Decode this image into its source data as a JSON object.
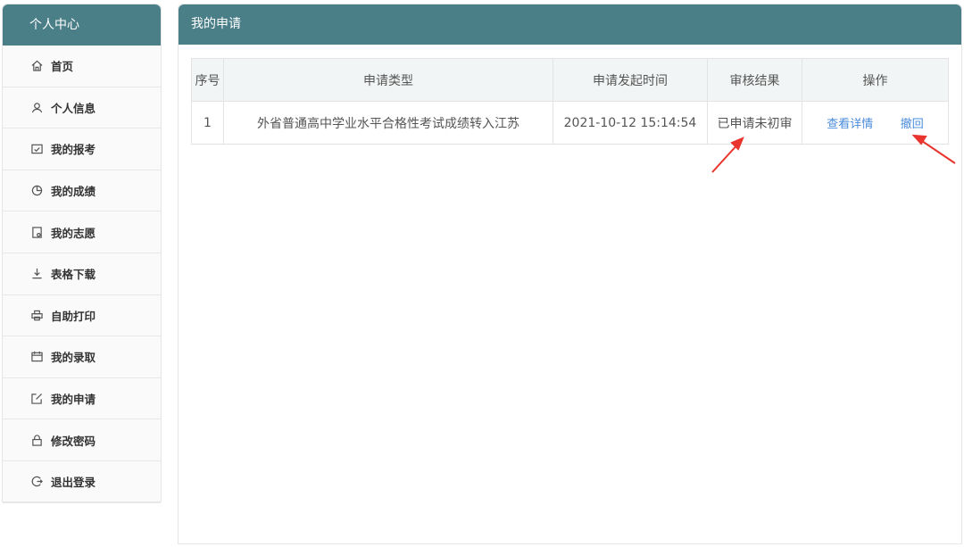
{
  "sidebar": {
    "title": "个人中心",
    "items": [
      {
        "label": "首页",
        "icon": "home-icon"
      },
      {
        "label": "个人信息",
        "icon": "user-icon"
      },
      {
        "label": "我的报考",
        "icon": "calendar-check-icon"
      },
      {
        "label": "我的成绩",
        "icon": "pie-chart-icon"
      },
      {
        "label": "我的志愿",
        "icon": "document-icon"
      },
      {
        "label": "表格下载",
        "icon": "download-icon"
      },
      {
        "label": "自助打印",
        "icon": "printer-icon"
      },
      {
        "label": "我的录取",
        "icon": "calendar-icon"
      },
      {
        "label": "我的申请",
        "icon": "edit-icon"
      },
      {
        "label": "修改密码",
        "icon": "lock-icon"
      },
      {
        "label": "退出登录",
        "icon": "logout-icon"
      }
    ]
  },
  "main": {
    "title": "我的申请",
    "table": {
      "headers": [
        "序号",
        "申请类型",
        "申请发起时间",
        "审核结果",
        "操作"
      ],
      "rows": [
        {
          "index": "1",
          "type": "外省普通高中学业水平合格性考试成绩转入江苏",
          "time": "2021-10-12 15:14:54",
          "result": "已申请未初审",
          "actions": [
            "查看详情",
            "撤回"
          ]
        }
      ]
    }
  },
  "colors": {
    "accent": "#4a7f88",
    "link": "#4a8bdc",
    "arrow": "#e8342c"
  }
}
